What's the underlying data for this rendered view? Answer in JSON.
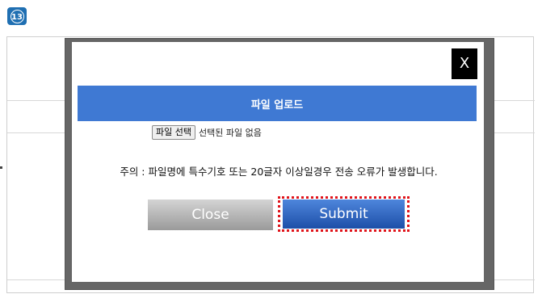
{
  "step_badge": "13",
  "modal": {
    "close_x": "X",
    "title": "파일 업로드",
    "file_input": {
      "button_label": "파일 선택",
      "status": "선택된 파일 없음"
    },
    "notice": "주의 : 파일명에 특수기호 또는 20글자 이상일경우 전송 오류가 발생합니다.",
    "close_button": "Close",
    "submit_button": "Submit"
  },
  "colors": {
    "title_bar": "#3f79d3",
    "highlight": "#e0141b",
    "badge": "#1f6fb2"
  }
}
